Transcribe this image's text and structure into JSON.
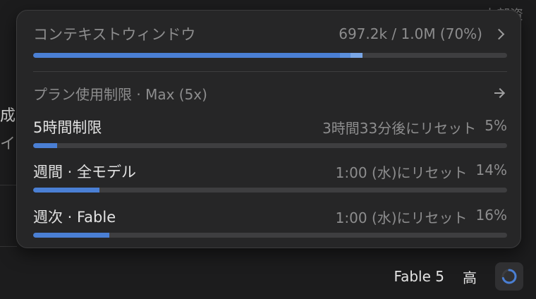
{
  "background": {
    "top_right_text": "内部资",
    "left_text_1": "成",
    "left_text_2": "イ"
  },
  "context": {
    "title": "コンテキストウィンドウ",
    "usage": "697.2k / 1.0M (70%)",
    "percent": 70,
    "segments": [
      {
        "from": 0,
        "to": 0.647,
        "color": "#4a7fd4"
      },
      {
        "from": 0.647,
        "to": 0.67,
        "color": "#5b8fdc"
      },
      {
        "from": 0.67,
        "to": 0.695,
        "color": "#79a6e6"
      }
    ]
  },
  "plan": {
    "title": "プラン使用制限 · Max (5x)"
  },
  "limits": [
    {
      "name": "5時間制限",
      "reset": "3時間33分後にリセット",
      "percent_text": "5%",
      "fraction": 0.05
    },
    {
      "name": "週間 · 全モデル",
      "reset": "1:00 (水)にリセット",
      "percent_text": "14%",
      "fraction": 0.14
    },
    {
      "name": "週次 · Fable",
      "reset": "1:00 (水)にリセット",
      "percent_text": "16%",
      "fraction": 0.16
    }
  ],
  "footer": {
    "model": "Fable 5",
    "effort": "高",
    "loader_fraction": 0.7
  },
  "colors": {
    "accent": "#4a7fd4"
  }
}
